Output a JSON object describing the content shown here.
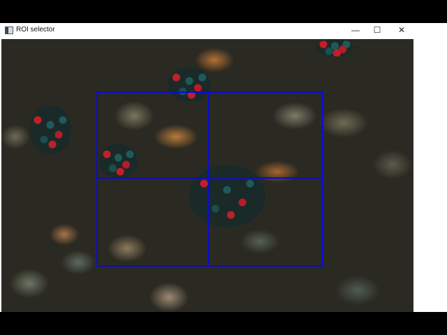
{
  "window": {
    "title": "ROI selector",
    "minimize_glyph": "—",
    "maximize_glyph": "☐",
    "close_glyph": "✕"
  },
  "roi": {
    "color": "#0a0adf"
  }
}
